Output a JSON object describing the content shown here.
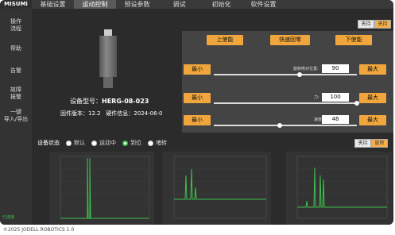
{
  "brand": "MISUMi",
  "tabs": [
    "基础设置",
    "运动控制",
    "预设参数",
    "调试",
    "初始化",
    "软件设置"
  ],
  "active_tab": 1,
  "sidebar": {
    "items": [
      "操作\n流程",
      "帮助",
      "告警",
      "故障\n报警",
      "一键\n导入/导出"
    ],
    "connection": "已连接"
  },
  "device": {
    "model_label": "设备型号：",
    "model": "HERG-08-023",
    "firmware_label": "固件版本：",
    "firmware": "12.2",
    "hardware_label": "硬件信息：",
    "hardware": "2024-06-0"
  },
  "top_toggle": {
    "left": "夹持",
    "right": "夹持"
  },
  "buttons": {
    "up": "上使能",
    "home": "快速回零",
    "down": "下使能"
  },
  "sliders": [
    {
      "min_label": "最小",
      "max_label": "最大",
      "name": "旋转绝对位置:",
      "value": "90",
      "fraction": 0.6
    },
    {
      "min_label": "最小",
      "max_label": "最大",
      "name": "力:",
      "value": "100",
      "fraction": 1.0
    },
    {
      "min_label": "最小",
      "max_label": "最大",
      "name": "速度:",
      "value": "46",
      "fraction": 0.46
    }
  ],
  "status": {
    "label": "设备状态",
    "options": [
      "默认",
      "运动中",
      "到位",
      "堵转"
    ],
    "selected": 2
  },
  "chart_toggle": {
    "left": "夹持",
    "right": "旋转"
  },
  "footer": "©2025 JODELL ROBOTICS 1.0",
  "colors": {
    "accent": "#f0a63c",
    "plot_line": "#3fbf4f",
    "bg": "#2b2b2b"
  }
}
